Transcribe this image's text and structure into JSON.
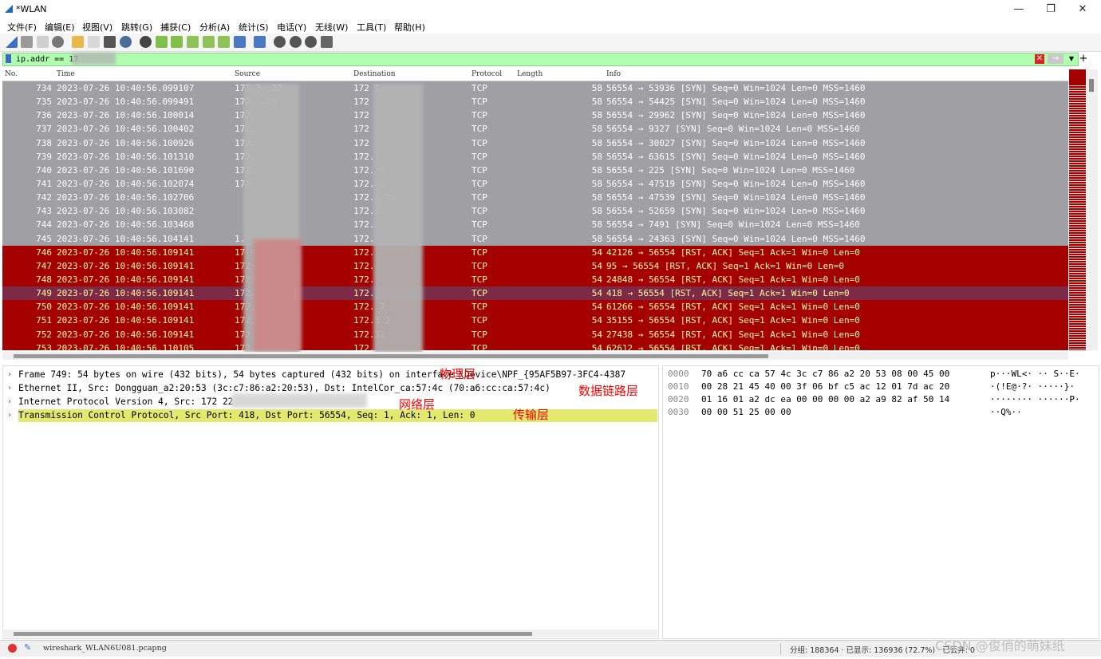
{
  "window": {
    "title": "*WLAN",
    "minimize": "—",
    "restore": "❐",
    "close": "✕"
  },
  "menu": [
    "文件(F)",
    "编辑(E)",
    "视图(V)",
    "跳转(G)",
    "捕获(C)",
    "分析(A)",
    "统计(S)",
    "电话(Y)",
    "无线(W)",
    "工具(T)",
    "帮助(H)"
  ],
  "toolbar_icons": [
    "shark-fin-start-icon",
    "stop-icon",
    "restart-icon",
    "options-gear-icon",
    "open-folder-icon",
    "save-file-icon",
    "close-file-icon",
    "reload-icon",
    "find-icon",
    "go-back-icon",
    "go-forward-icon",
    "go-to-packet-icon",
    "first-packet-icon",
    "last-packet-icon",
    "autoscroll-icon",
    "colorize-icon",
    "zoom-in-icon",
    "zoom-out-icon",
    "zoom-normal-icon",
    "resize-columns-icon"
  ],
  "filter": {
    "value": "ip.addr == 17",
    "add": "+"
  },
  "columns": {
    "no": "No.",
    "time": "Time",
    "source": "Source",
    "destination": "Destination",
    "protocol": "Protocol",
    "length": "Length",
    "info": "Info"
  },
  "packets": [
    {
      "no": "734",
      "time": "2023-07-26 10:40:56.099107",
      "src": "172.3   .22",
      "dst": "172    1.",
      "proto": "TCP",
      "len": "58",
      "info": "56554 → 53936 [SYN] Seq=0 Win=1024 Len=0 MSS=1460",
      "color": "gray"
    },
    {
      "no": "735",
      "time": "2023-07-26 10:40:56.099491",
      "src": "172.    .22",
      "dst": "172",
      "proto": "TCP",
      "len": "58",
      "info": "56554 → 54425 [SYN] Seq=0 Win=1024 Len=0 MSS=1460",
      "color": "gray"
    },
    {
      "no": "736",
      "time": "2023-07-26 10:40:56.100014",
      "src": "172.",
      "dst": "172",
      "proto": "TCP",
      "len": "58",
      "info": "56554 → 29962 [SYN] Seq=0 Win=1024 Len=0 MSS=1460",
      "color": "gray"
    },
    {
      "no": "737",
      "time": "2023-07-26 10:40:56.100402",
      "src": "172.",
      "dst": "172",
      "proto": "TCP",
      "len": "58",
      "info": "56554 → 9327 [SYN] Seq=0 Win=1024 Len=0 MSS=1460",
      "color": "gray"
    },
    {
      "no": "738",
      "time": "2023-07-26 10:40:56.100926",
      "src": "172.",
      "dst": "172",
      "proto": "TCP",
      "len": "58",
      "info": "56554 → 30027 [SYN] Seq=0 Win=1024 Len=0 MSS=1460",
      "color": "gray"
    },
    {
      "no": "739",
      "time": "2023-07-26 10:40:56.101310",
      "src": "172.",
      "dst": "172.",
      "proto": "TCP",
      "len": "58",
      "info": "56554 → 63615 [SYN] Seq=0 Win=1024 Len=0 MSS=1460",
      "color": "gray"
    },
    {
      "no": "740",
      "time": "2023-07-26 10:40:56.101690",
      "src": "172.",
      "dst": "172.        5",
      "proto": "TCP",
      "len": "58",
      "info": "56554 → 225 [SYN] Seq=0 Win=1024 Len=0 MSS=1460",
      "color": "gray"
    },
    {
      "no": "741",
      "time": "2023-07-26 10:40:56.102074",
      "src": "172",
      "dst": "172.        5",
      "proto": "TCP",
      "len": "58",
      "info": "56554 → 47519 [SYN] Seq=0 Win=1024 Len=0 MSS=1460",
      "color": "gray"
    },
    {
      "no": "742",
      "time": "2023-07-26 10:40:56.102706",
      "src": "",
      "dst": "172.1     25",
      "proto": "TCP",
      "len": "58",
      "info": "56554 → 47539 [SYN] Seq=0 Win=1024 Len=0 MSS=1460",
      "color": "gray"
    },
    {
      "no": "743",
      "time": "2023-07-26 10:40:56.103082",
      "src": "",
      "dst": "172.1",
      "proto": "TCP",
      "len": "58",
      "info": "56554 → 52659 [SYN] Seq=0 Win=1024 Len=0 MSS=1460",
      "color": "gray"
    },
    {
      "no": "744",
      "time": "2023-07-26 10:40:56.103468",
      "src": "",
      "dst": "172.",
      "proto": "TCP",
      "len": "58",
      "info": "56554 → 7491 [SYN] Seq=0 Win=1024 Len=0 MSS=1460",
      "color": "gray"
    },
    {
      "no": "745",
      "time": "2023-07-26 10:40:56.104141",
      "src": "1.",
      "dst": "172.",
      "proto": "TCP",
      "len": "58",
      "info": "56554 → 24363 [SYN] Seq=0 Win=1024 Len=0 MSS=1460",
      "color": "gray"
    },
    {
      "no": "746",
      "time": "2023-07-26 10:40:56.109141",
      "src": "17      5",
      "dst": "172.",
      "proto": "TCP",
      "len": "54",
      "info": "42126 → 56554 [RST, ACK] Seq=1 Ack=1 Win=0 Len=0",
      "color": "red"
    },
    {
      "no": "747",
      "time": "2023-07-26 10:40:56.109141",
      "src": "172",
      "dst": "172.",
      "proto": "TCP",
      "len": "54",
      "info": "95 → 56554 [RST, ACK] Seq=1 Ack=1 Win=0 Len=0",
      "color": "red"
    },
    {
      "no": "748",
      "time": "2023-07-26 10:40:56.109141",
      "src": "172.1",
      "dst": "172.",
      "proto": "TCP",
      "len": "54",
      "info": "24848 → 56554 [RST, ACK] Seq=1 Ack=1 Win=0 Len=0",
      "color": "red"
    },
    {
      "no": "749",
      "time": "2023-07-26 10:40:56.109141",
      "src": "172.1",
      "dst": "172.",
      "proto": "TCP",
      "len": "54",
      "info": "418 → 56554 [RST, ACK] Seq=1 Ack=1 Win=0 Len=0",
      "color": "selected"
    },
    {
      "no": "750",
      "time": "2023-07-26 10:40:56.109141",
      "src": "172.1",
      "dst": "172.        2",
      "proto": "TCP",
      "len": "54",
      "info": "61266 → 56554 [RST, ACK] Seq=1 Ack=1 Win=0 Len=0",
      "color": "red"
    },
    {
      "no": "751",
      "time": "2023-07-26 10:40:56.109141",
      "src": "172.1",
      "dst": "172.3      2",
      "proto": "TCP",
      "len": "54",
      "info": "35155 → 56554 [RST, ACK] Seq=1 Ack=1 Win=0 Len=0",
      "color": "red"
    },
    {
      "no": "752",
      "time": "2023-07-26 10:40:56.109141",
      "src": "172.",
      "dst": "172.32",
      "proto": "TCP",
      "len": "54",
      "info": "27438 → 56554 [RST, ACK] Seq=1 Ack=1 Win=0 Len=0",
      "color": "red"
    },
    {
      "no": "753",
      "time": "2023-07-26 10:40:56.110105",
      "src": "172.1",
      "dst": "172.",
      "proto": "TCP",
      "len": "54",
      "info": "62612 → 56554 [RST, ACK] Seq=1 Ack=1 Win=0 Len=0",
      "color": "red"
    }
  ],
  "details": [
    {
      "arrow": "›",
      "text": "Frame 749: 54 bytes on wire (432 bits), 54 bytes captured (432 bits) on interface \\Device\\NPF_{95AF5B97-3FC4-4387",
      "highlight": false
    },
    {
      "arrow": "›",
      "text": "Ethernet II, Src: Dongguan_a2:20:53 (3c:c7:86:a2:20:53), Dst: IntelCor_ca:57:4c (70:a6:cc:ca:57:4c)",
      "highlight": false
    },
    {
      "arrow": "›",
      "text": "Internet Protocol Version 4, Src: 172                          22",
      "highlight": false
    },
    {
      "arrow": "›",
      "text": "Transmission Control Protocol, Src Port: 418, Dst Port: 56554, Seq: 1, Ack: 1, Len: 0",
      "highlight": true
    }
  ],
  "annotations": {
    "physical": "物理层",
    "datalink": "数据链路层",
    "network": "网络层",
    "transport": "传输层"
  },
  "hex": [
    {
      "off": "0000",
      "bytes": "70 a6 cc ca 57 4c 3c c7  86 a2 20 53 08 00 45 00",
      "ascii": "p···WL<· ·· S··E·"
    },
    {
      "off": "0010",
      "bytes": "00 28 21 45 40 00 3f 06  bf c5 ac 12 01 7d ac 20",
      "ascii": "·(!E@·?· ·····}· "
    },
    {
      "off": "0020",
      "bytes": "01 16 01 a2 dc ea 00 00  00 00 a2 a9 82 af 50 14",
      "ascii": "········ ······P·"
    },
    {
      "off": "0030",
      "bytes": "00 00 51 25 00 00",
      "ascii": "··Q%··"
    }
  ],
  "status": {
    "file": "wireshark_WLAN6U081.pcapng",
    "stats": "分组: 188364 · 已显示: 136936 (72.7%) · 已丢弃: 0",
    "watermark": "CSDN @俊俏的萌妹纸"
  }
}
